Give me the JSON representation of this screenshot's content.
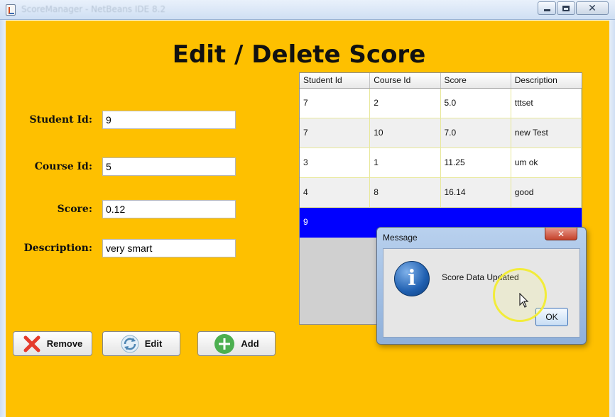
{
  "window": {
    "title": "ScoreManager - NetBeans IDE 8.2"
  },
  "form": {
    "heading": "Edit / Delete Score",
    "fields": [
      {
        "label": "Student Id:",
        "value": "9"
      },
      {
        "label": "Course Id:",
        "value": "5"
      },
      {
        "label": "Score:",
        "value": "0.12"
      },
      {
        "label": "Description:",
        "value": "very smart"
      }
    ]
  },
  "buttons": {
    "remove": "Remove",
    "edit": "Edit",
    "add": "Add"
  },
  "table": {
    "columns": [
      "Student Id",
      "Course Id",
      "Score",
      "Description"
    ],
    "rows": [
      [
        "7",
        "2",
        "5.0",
        "tttset"
      ],
      [
        "7",
        "10",
        "7.0",
        "new Test"
      ],
      [
        "3",
        "1",
        "11.25",
        "um ok"
      ],
      [
        "4",
        "8",
        "16.14",
        "good"
      ],
      [
        "9",
        "",
        "",
        ""
      ]
    ],
    "selected_row": 4
  },
  "dialog": {
    "title": "Message",
    "message": "Score Data Updated",
    "ok_label": "OK"
  },
  "colors": {
    "panel_background": "#fec000",
    "selection": "#0000ff",
    "remove_icon": "#e53b2c",
    "add_icon": "#4caf50"
  }
}
